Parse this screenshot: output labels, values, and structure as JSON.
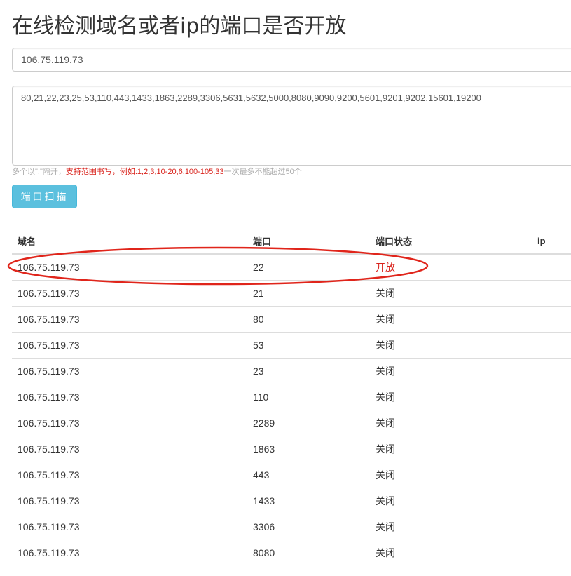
{
  "page": {
    "title": "在线检测域名或者ip的端口是否开放"
  },
  "form": {
    "host_value": "106.75.119.73",
    "ports_value": "80,21,22,23,25,53,110,443,1433,1863,2289,3306,5631,5632,5000,8080,9090,9200,5601,9201,9202,15601,19200",
    "hint_prefix": "多个以\",\"隔开，",
    "hint_red": "支持范围书写，例如:1,2,3,10-20,6,100-105,33",
    "hint_suffix": "一次最多不能超过50个",
    "scan_label": "端口扫描"
  },
  "table": {
    "headers": [
      "域名",
      "端口",
      "端口状态",
      "ip"
    ],
    "rows": [
      {
        "domain": "106.75.119.73",
        "port": "22",
        "status": "开放",
        "ip": ""
      },
      {
        "domain": "106.75.119.73",
        "port": "21",
        "status": "关闭",
        "ip": ""
      },
      {
        "domain": "106.75.119.73",
        "port": "80",
        "status": "关闭",
        "ip": ""
      },
      {
        "domain": "106.75.119.73",
        "port": "53",
        "status": "关闭",
        "ip": ""
      },
      {
        "domain": "106.75.119.73",
        "port": "23",
        "status": "关闭",
        "ip": ""
      },
      {
        "domain": "106.75.119.73",
        "port": "110",
        "status": "关闭",
        "ip": ""
      },
      {
        "domain": "106.75.119.73",
        "port": "2289",
        "status": "关闭",
        "ip": ""
      },
      {
        "domain": "106.75.119.73",
        "port": "1863",
        "status": "关闭",
        "ip": ""
      },
      {
        "domain": "106.75.119.73",
        "port": "443",
        "status": "关闭",
        "ip": ""
      },
      {
        "domain": "106.75.119.73",
        "port": "1433",
        "status": "关闭",
        "ip": ""
      },
      {
        "domain": "106.75.119.73",
        "port": "3306",
        "status": "关闭",
        "ip": ""
      },
      {
        "domain": "106.75.119.73",
        "port": "8080",
        "status": "关闭",
        "ip": ""
      }
    ]
  },
  "colors": {
    "open_status": "#d9231c",
    "button_bg": "#5bc0de",
    "annotation": "#e0251b"
  }
}
